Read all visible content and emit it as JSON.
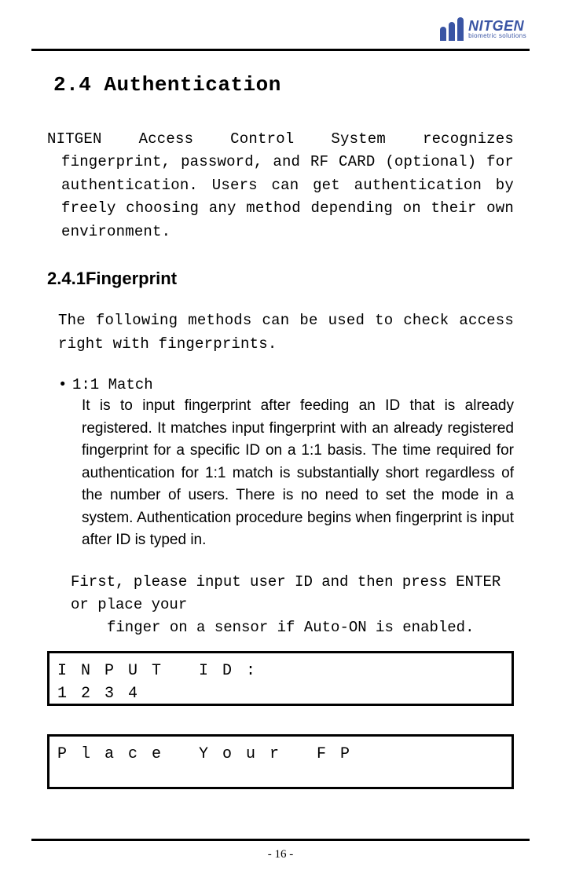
{
  "logo": {
    "brand": "NITGEN",
    "tagline": "biometric solutions"
  },
  "section": {
    "number": "2.4",
    "title": "Authentication"
  },
  "intro": "NITGEN Access Control System recognizes fingerprint, password, and RF CARD (optional) for authentication. Users can get authentication by freely choosing any method depending on their own environment.",
  "subsection": {
    "number": "2.4.1",
    "title": "Fingerprint"
  },
  "sub_intro": "The following methods can be used to check access right with fingerprints.",
  "bullet": {
    "head": "1:1 Match",
    "body": "It is to input fingerprint after feeding an ID that is already registered. It matches input fingerprint with an already registered fingerprint for a specific ID on a 1:1 basis. The time required for authentication for 1:1 match is substantially short regardless of the number of users. There is no need to set the mode in a system. Authentication procedure begins when fingerprint is input after ID is typed in."
  },
  "instruction_line1": "First, please input user ID and then press ENTER or place your",
  "instruction_line2": "finger on a sensor if Auto-ON is enabled.",
  "lcd1": {
    "row1": [
      "I",
      "N",
      "P",
      "U",
      "T",
      "",
      "I",
      "D",
      ":",
      "",
      "",
      "",
      "",
      "",
      ""
    ],
    "row2": [
      "1",
      "2",
      "3",
      "4",
      "",
      "",
      "",
      "",
      "",
      "",
      "",
      "",
      "",
      "",
      ""
    ]
  },
  "lcd2": {
    "row1": [
      "P",
      "l",
      "a",
      "c",
      "e",
      "",
      "Y",
      "o",
      "u",
      "r",
      "",
      "F",
      "P",
      "",
      ""
    ],
    "row2": [
      "",
      "",
      "",
      "",
      "",
      "",
      "",
      "",
      "",
      "",
      "",
      "",
      "",
      "",
      ""
    ]
  },
  "page_number": "- 16 -"
}
